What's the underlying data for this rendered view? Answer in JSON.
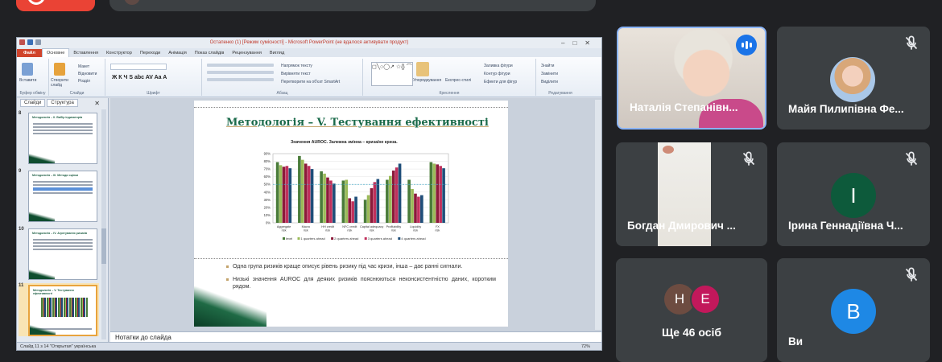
{
  "ppt": {
    "window_title": "Остапенко (1) [Режим сумісності] - Microsoft PowerPoint (не вдалося активувати продукт)",
    "tabs": [
      "Файл",
      "Основне",
      "Вставлення",
      "Конструктор",
      "Переходи",
      "Анімація",
      "Показ слайдів",
      "Рецензування",
      "Вигляд"
    ],
    "ribbon_groups": [
      "Буфер обміну",
      "Слайди",
      "Шрифт",
      "Абзац",
      "Креслення",
      "Редагування"
    ],
    "ribbon_labels": {
      "paste": "Вставити",
      "new_slide": "Створити слайд",
      "layout": "Макет",
      "reset": "Відновити",
      "section": "Розділ",
      "text_direction": "Напрямок тексту",
      "align_text": "Вирівняти текст",
      "smartart": "Перетворити на об'єкт SmartArt",
      "arrange": "Упорядкування",
      "quick_styles": "Експрес-стилі",
      "shape_fill": "Заливка фігури",
      "shape_outline": "Контур фігури",
      "shape_effects": "Ефекти для фігур",
      "find": "Знайти",
      "replace": "Замінити",
      "select": "Виділити"
    },
    "side_tabs": [
      "Слайди",
      "Структура"
    ],
    "thumbnails": [
      {
        "num": "8",
        "title": "Методологія – II. Вибір індикаторів"
      },
      {
        "num": "9",
        "title": "Методологія – III. Методи оцінки"
      },
      {
        "num": "10",
        "title": "Методологія – IV. Агрегування ризиків"
      },
      {
        "num": "11",
        "title": "Методологія – V. Тестування ефективності"
      }
    ],
    "slide": {
      "title": "Методологія – V. Тестування ефективності",
      "chart_title": "Значення AUROC. Залежна змінна – криза/не криза.",
      "bullets": [
        "Одна група ризиків краще описує рівень ризику під час кризи, інша – дає ранні сигнали.",
        "Низькі значення AUROC для деяких ризиків пояснюються неконсистентністю даних, коротким рядом."
      ]
    },
    "notes_placeholder": "Нотатки до слайда",
    "status_left": "Слайд 11 з 14   \"Открытая\"   українська",
    "zoom": "72%"
  },
  "chart_data": {
    "type": "bar",
    "title": "Значення AUROC. Залежна змінна – криза/не криза.",
    "categories": [
      "Aggregate risk",
      "Macro risk",
      "HH credit risk",
      "NFC credit risk",
      "Capital adequacy risk",
      "Profitability risk",
      "Liquidity risk",
      "FX risk"
    ],
    "ylim": [
      0,
      90
    ],
    "yticks": [
      "0%",
      "10%",
      "20%",
      "30%",
      "40%",
      "50%",
      "60%",
      "70%",
      "80%",
      "90%"
    ],
    "reference_line": 50,
    "series": [
      {
        "name": "level",
        "color": "#4a7c3a",
        "values": [
          79,
          87,
          67,
          55,
          30,
          56,
          56,
          79
        ]
      },
      {
        "name": "1 quarters ahead",
        "color": "#9bbb59",
        "values": [
          75,
          82,
          64,
          56,
          36,
          61,
          44,
          77
        ]
      },
      {
        "name": "2 quarters ahead",
        "color": "#8b1a3a",
        "values": [
          73,
          77,
          59,
          32,
          45,
          68,
          38,
          76
        ]
      },
      {
        "name": "3 quarters ahead",
        "color": "#c0305c",
        "values": [
          74,
          74,
          55,
          28,
          53,
          72,
          34,
          74
        ]
      },
      {
        "name": "4 quarters ahead",
        "color": "#1f4e79",
        "values": [
          71,
          70,
          51,
          34,
          57,
          77,
          36,
          71
        ]
      }
    ],
    "legend": "bottom"
  },
  "participants": [
    {
      "name": "Наталія Степанівна Остапенко",
      "display": "Наталія Степанівн...",
      "speaking": true
    },
    {
      "name": "Майя Пилипівна Фе...",
      "muted": true
    },
    {
      "name": "Богдан Дмирович ...",
      "muted": true
    },
    {
      "name": "Ірина Геннадіївна Ч...",
      "initial": "І",
      "avatar_color": "#0d5a3b",
      "muted": true
    },
    {
      "label": "Ще 46 осіб",
      "initials": [
        "Н",
        "Е"
      ],
      "colors": [
        "#6d4c41",
        "#c2185b"
      ]
    },
    {
      "name": "Ви",
      "initial": "В",
      "avatar_color": "#1e88e5",
      "muted": true
    }
  ],
  "colors": {
    "background": "#202124",
    "tile": "#3c4043",
    "active_border": "#8ab4f8",
    "accent_red": "#ea4335"
  }
}
